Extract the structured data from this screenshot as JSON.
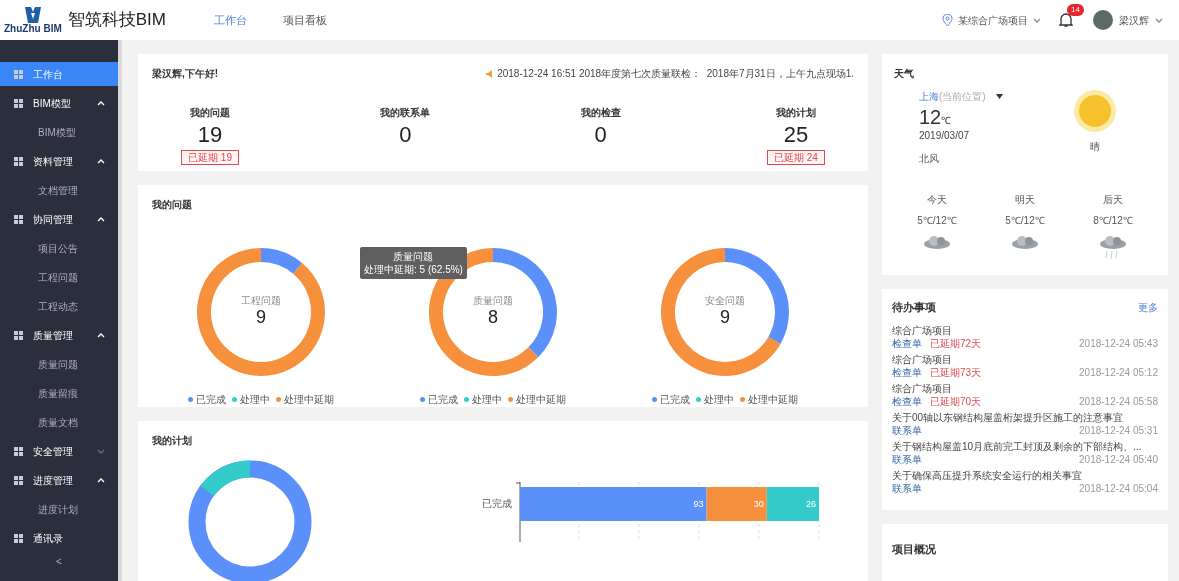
{
  "header": {
    "brand": "智筑科技BIM",
    "logo_caption": "ZhuZhu BIM",
    "nav": [
      {
        "label": "工作台",
        "selected": true
      },
      {
        "label": "项目看板",
        "selected": false
      }
    ],
    "project": "某综合广场项目",
    "notifications": "14",
    "user": "梁汉辉"
  },
  "sidebar": {
    "items": [
      {
        "label": "工作台",
        "selected": true
      },
      {
        "label": "BIM模型",
        "selected": false,
        "expanded": true,
        "children": [
          {
            "label": "BIM模型"
          }
        ]
      },
      {
        "label": "资料管理",
        "selected": false,
        "expanded": true,
        "children": [
          {
            "label": "文档管理"
          }
        ]
      },
      {
        "label": "协同管理",
        "selected": false,
        "expanded": true,
        "children": [
          {
            "label": "项目公告"
          },
          {
            "label": "工程问题"
          },
          {
            "label": "工程动态"
          }
        ]
      },
      {
        "label": "质量管理",
        "selected": false,
        "expanded": true,
        "children": [
          {
            "label": "质量问题"
          },
          {
            "label": "质量留痕"
          },
          {
            "label": "质量文档"
          }
        ]
      },
      {
        "label": "安全管理",
        "selected": false,
        "expanded": false
      },
      {
        "label": "进度管理",
        "selected": false,
        "expanded": true,
        "children": [
          {
            "label": "进度计划"
          }
        ]
      },
      {
        "label": "通讯录",
        "selected": false
      }
    ],
    "collapse": "<"
  },
  "summary": {
    "greeting": "梁汉辉,下午好!",
    "notice": "2018-12-24 16:51 2018年度第七次质量联检：  2018年7月31日，上午九点现场1.",
    "stats": [
      {
        "label": "我的问题",
        "value": "19",
        "badge": "已延期 19"
      },
      {
        "label": "我的联系单",
        "value": "0"
      },
      {
        "label": "我的检查",
        "value": "0"
      },
      {
        "label": "我的计划",
        "value": "25",
        "badge": "已延期 24"
      }
    ]
  },
  "issues": {
    "title": "我的问题",
    "slices": [
      {
        "color": "#5b8ff9"
      },
      {
        "color": "#36cbcb"
      },
      {
        "color": "#f6903d"
      }
    ],
    "charts": [
      {
        "chart_data": {
          "type": "donut",
          "title": "工程问题",
          "categories": [
            "已完成",
            "处理中",
            "处理中延期"
          ],
          "values": [
            11.1,
            0,
            88.9
          ]
        },
        "total": "9"
      },
      {
        "chart_data": {
          "type": "donut",
          "title": "质量问题",
          "categories": [
            "已完成",
            "处理中",
            "处理中延期"
          ],
          "values": [
            37.5,
            0,
            62.5
          ]
        },
        "total": "8"
      },
      {
        "chart_data": {
          "type": "donut",
          "title": "安全问题",
          "categories": [
            "已完成",
            "处理中",
            "处理中延期"
          ],
          "values": [
            33.3,
            0,
            66.7
          ]
        },
        "total": "9"
      }
    ],
    "tooltip": {
      "title": "质量问题",
      "text": "处理中延期: 5 (62.5%)"
    }
  },
  "plans": {
    "title": "我的计划",
    "bar_chart": {
      "chart_data": {
        "type": "bar",
        "orientation": "horizontal",
        "stacked": true,
        "categories": [
          "已完成"
        ],
        "series": [
          {
            "color": "#5b8ff9",
            "values": [
              93
            ]
          },
          {
            "color": "#f6903d",
            "values": [
              30
            ]
          },
          {
            "color": "#36cbcb",
            "values": [
              26
            ]
          }
        ],
        "data_labels": true
      }
    }
  },
  "weather": {
    "title": "天气",
    "city": "上海",
    "city_note": "(当前位置)",
    "temp": "12",
    "unit": "℃",
    "date": "2019/03/07",
    "wind": "北风",
    "condition": "晴",
    "forecast": [
      {
        "day": "今天",
        "range": "5℃/12℃",
        "kind": "cloudy"
      },
      {
        "day": "明天",
        "range": "5℃/12℃",
        "kind": "cloudy"
      },
      {
        "day": "后天",
        "range": "8℃/12℃",
        "kind": "rain"
      }
    ]
  },
  "todo": {
    "title": "待办事项",
    "more": "更多",
    "items": [
      {
        "title": "综合广场项目",
        "tag": "检查单",
        "overdue": "已延期72天",
        "time": "2018-12-24 05:43"
      },
      {
        "title": "综合广场项目",
        "tag": "检查单",
        "overdue": "已延期73天",
        "time": "2018-12-24 05:12"
      },
      {
        "title": "综合广场项目",
        "tag": "检查单",
        "overdue": "已延期70天",
        "time": "2018-12-24 05:58"
      },
      {
        "title": "关于00轴以东钢结构屋盖桁架提升区施工的注意事宜",
        "tag": "联系单",
        "time": "2018-12-24 05:31"
      },
      {
        "title": "关于钢结构屋盖10月底前完工封顶及剩余的下部结构、...",
        "tag": "联系单",
        "time": "2018-12-24 05:40"
      },
      {
        "title": "关于确保高压提升系统安全运行的相关事宜",
        "tag": "联系单",
        "time": "2018-12-24 05:04"
      }
    ]
  },
  "overview": {
    "title": "项目概况"
  }
}
